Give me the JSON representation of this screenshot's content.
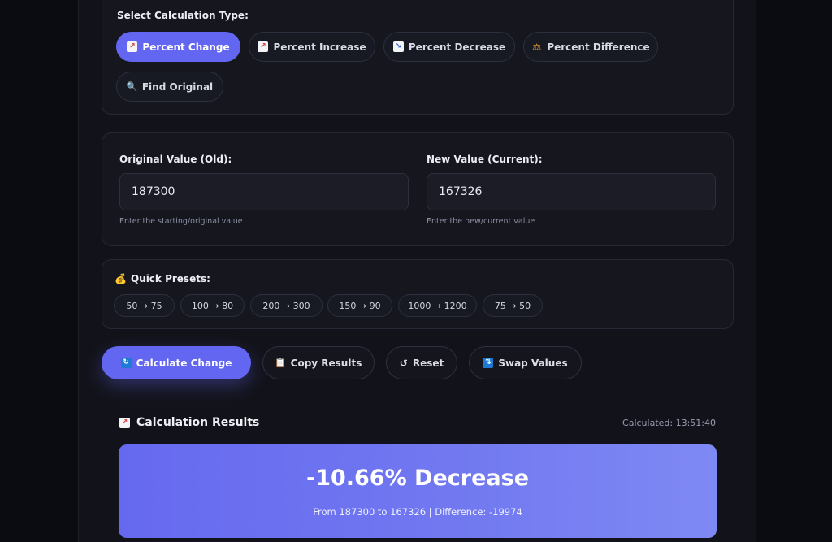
{
  "calc_type": {
    "label": "Select Calculation Type:",
    "options": [
      {
        "label": "Percent Change",
        "icon": "chart-up-icon",
        "active": true
      },
      {
        "label": "Percent Increase",
        "icon": "chart-up-icon",
        "active": false
      },
      {
        "label": "Percent Decrease",
        "icon": "chart-down-icon",
        "active": false
      },
      {
        "label": "Percent Difference",
        "icon": "scale-icon",
        "active": false
      },
      {
        "label": "Find Original",
        "icon": "magnifier-icon",
        "active": false
      }
    ]
  },
  "inputs": {
    "original": {
      "label": "Original Value (Old):",
      "value": "187300",
      "hint": "Enter the starting/original value"
    },
    "new": {
      "label": "New Value (Current):",
      "value": "167326",
      "hint": "Enter the new/current value"
    }
  },
  "presets": {
    "label": "Quick Presets:",
    "icon": "money-bag-icon",
    "items": [
      "50 → 75",
      "100 → 80",
      "200 → 300",
      "150 → 90",
      "1000 → 1200",
      "75 → 50"
    ]
  },
  "actions": {
    "calculate": "Calculate Change",
    "copy": "Copy Results",
    "reset": "Reset",
    "swap": "Swap Values"
  },
  "results": {
    "title": "Calculation Results",
    "timestamp": "Calculated: 13:51:40",
    "main": "-10.66% Decrease",
    "detail": "From 187300 to 167326 | Difference: -19974"
  },
  "colors": {
    "accent": "#6366f1",
    "background": "#12131a",
    "card": "#15161e"
  }
}
